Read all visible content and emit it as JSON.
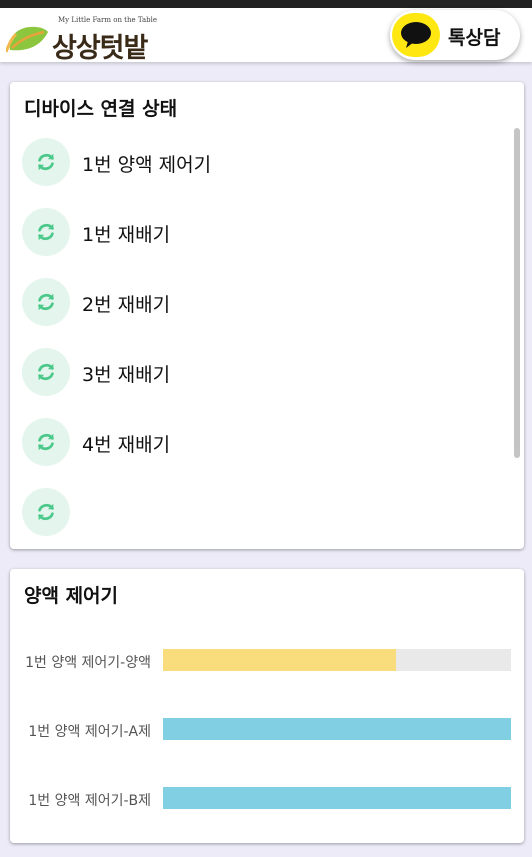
{
  "header": {
    "logo_tagline": "My Little Farm on the Table",
    "logo_text": "상상텃밭",
    "kakao_label": "톡상담",
    "kakao_color": "#ffe812"
  },
  "devices_card": {
    "title": "디바이스 연결 상태",
    "icon": "refresh-icon",
    "icon_color": "#4cc98a",
    "items": [
      {
        "label": "1번 양액 제어기"
      },
      {
        "label": "1번 재배기"
      },
      {
        "label": "2번 재배기"
      },
      {
        "label": "3번 재배기"
      },
      {
        "label": "4번 재배기"
      },
      {
        "label": ""
      }
    ]
  },
  "nutrient_card": {
    "title": "양액 제어기",
    "bars": [
      {
        "label": "1번 양액 제어기-양액",
        "level": 0.67,
        "color": "#f9dc7c"
      },
      {
        "label": "1번 양액 제어기-A제",
        "level": 1.0,
        "color": "#80cfe3"
      },
      {
        "label": "1번 양액 제어기-B제",
        "level": 1.0,
        "color": "#80cfe3"
      }
    ]
  }
}
